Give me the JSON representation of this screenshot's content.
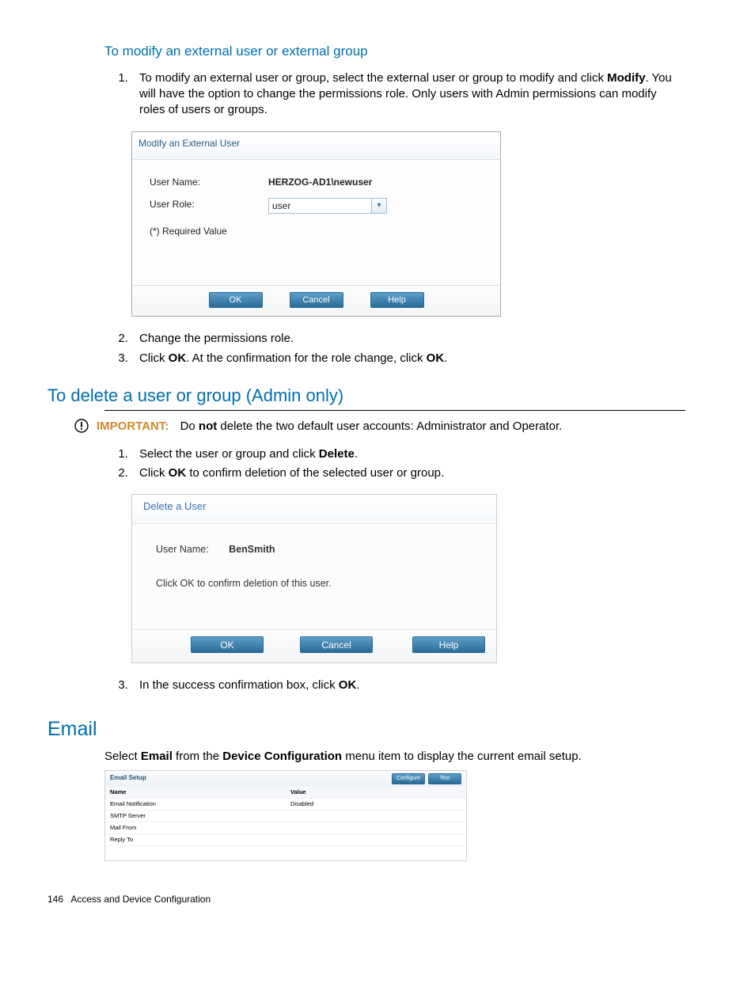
{
  "section1": {
    "heading": "To modify an external user or external group",
    "items": [
      {
        "prefix": "To modify an external user or group, select the external user or group to modify and click ",
        "bold": "Modify",
        "suffix": ". You will have the option to change the permissions role. Only users with Admin permissions can modify roles of users or groups."
      }
    ],
    "items_after": [
      "Change the permissions role.",
      {
        "prefix": "Click ",
        "b1": "OK",
        "mid": ". At the confirmation for the role change, click ",
        "b2": "OK",
        "suffix": "."
      }
    ]
  },
  "dialog1": {
    "title": "Modify an External User",
    "labels": {
      "username": "User Name:",
      "userrole": "User Role:",
      "req": "(*) Required Value"
    },
    "username": "HERZOG-AD1\\newuser",
    "role": "user",
    "buttons": {
      "ok": "OK",
      "cancel": "Cancel",
      "help": "Help"
    }
  },
  "section2": {
    "heading": "To delete a user or group (Admin only)",
    "important": {
      "label": "IMPORTANT:",
      "prefix": "Do ",
      "bold": "not",
      "suffix": " delete the two default user accounts: Administrator and Operator."
    },
    "items": [
      {
        "prefix": "Select the user or group and click ",
        "bold": "Delete",
        "suffix": "."
      },
      {
        "prefix": "Click ",
        "bold": "OK",
        "suffix": " to confirm deletion of the selected user or group."
      }
    ],
    "items_after": [
      {
        "prefix": "In the success confirmation box, click ",
        "bold": "OK",
        "suffix": "."
      }
    ]
  },
  "dialog2": {
    "title": "Delete a User",
    "userlabel": "User Name:",
    "username": "BenSmith",
    "confirm": "Click OK to confirm deletion of this user.",
    "buttons": {
      "ok": "OK",
      "cancel": "Cancel",
      "help": "Help"
    }
  },
  "section3": {
    "heading": "Email",
    "intro": {
      "prefix": "Select ",
      "b1": "Email",
      "mid": " from the ",
      "b2": "Device Configuration",
      "suffix": " menu item to display the current email setup."
    }
  },
  "emailTable": {
    "title": "Email Setup",
    "buttons": {
      "configure": "Configure",
      "test": "Test"
    },
    "cols": {
      "name": "Name",
      "value": "Value"
    },
    "rows": [
      {
        "name": "Email Notification",
        "value": "Disabled"
      },
      {
        "name": "SMTP Server",
        "value": ""
      },
      {
        "name": "Mail From",
        "value": ""
      },
      {
        "name": "Reply To",
        "value": ""
      }
    ]
  },
  "footer": {
    "page": "146",
    "chapter": "Access and Device Configuration"
  }
}
